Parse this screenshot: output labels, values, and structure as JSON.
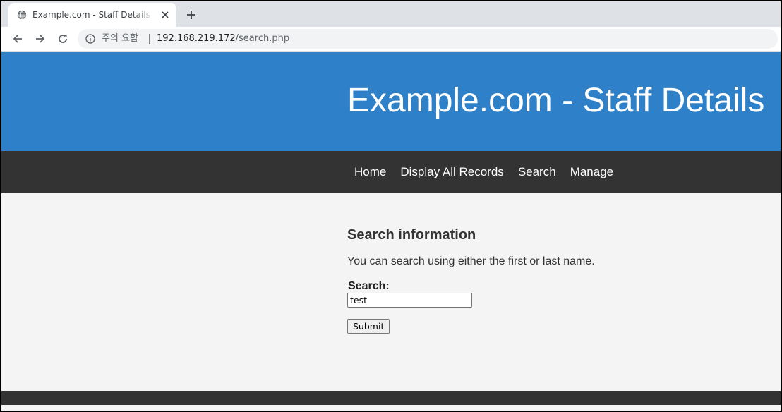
{
  "browser": {
    "tab": {
      "title": "Example.com - Staff Details - Web",
      "favicon": "globe-icon",
      "close_icon": "close-icon"
    },
    "new_tab_icon": "plus-icon",
    "toolbar": {
      "back_icon": "arrow-left-icon",
      "forward_icon": "arrow-right-icon",
      "reload_icon": "reload-icon"
    },
    "omnibox": {
      "security_icon": "info-icon",
      "security_label": "주의 요함",
      "url_host": "192.168.219.172",
      "url_path": "/search.php"
    }
  },
  "page": {
    "site_title": "Example.com - Staff Details",
    "nav": [
      {
        "label": "Home"
      },
      {
        "label": "Display All Records"
      },
      {
        "label": "Search"
      },
      {
        "label": "Manage"
      }
    ],
    "content": {
      "heading": "Search information",
      "description": "You can search using either the first or last name.",
      "search_label": "Search:",
      "search_value": "test",
      "submit_label": "Submit"
    }
  },
  "colors": {
    "header_bg": "#2e81c8",
    "nav_bg": "#333333",
    "content_bg": "#f4f4f4",
    "footer_bg": "#333333",
    "tabstrip_bg": "#dee1e6"
  }
}
